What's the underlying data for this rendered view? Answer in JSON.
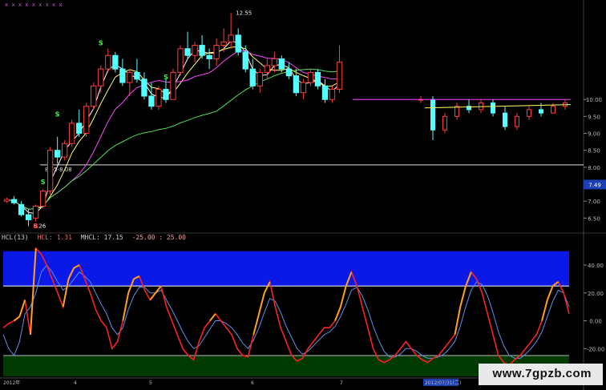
{
  "colors": {
    "background": "#000000",
    "candle_up": "#ff3b3b",
    "candle_down": "#54ffff",
    "ma_short": "#ffffff",
    "ma_mid": "#ffff66",
    "ma_long": "#ff44ff",
    "ma_longest": "#55dd55",
    "hcl": "#ff2020",
    "hcl_alt": "#ffa020",
    "mhcl": "#5f8fe8",
    "band_high": "#0a18e8",
    "band_low": "#003a00",
    "axis_text": "#bbbbbb",
    "price_badge": "#1b3fb3"
  },
  "chart_data": [
    {
      "type": "candlestick",
      "price_axis_ticks": [
        "10.00",
        "9.50",
        "9.00",
        "8.50",
        "8.00",
        "7.50",
        "7.00",
        "6.50"
      ],
      "ylim": [
        6.2,
        12.7
      ],
      "current_price_badge": "7.49",
      "annotations": {
        "high_label": "12.55",
        "low_label": "6.26",
        "horizontal_line_label": "8.05-8.08",
        "signal_marks": [
          "S",
          "S",
          "S",
          "S",
          "B"
        ]
      },
      "top_markers": "x x x x x x x x x",
      "series": [
        {
          "name": "candles",
          "values": [
            [
              7.0,
              7.1,
              6.95,
              7.05
            ],
            [
              7.05,
              7.15,
              6.9,
              6.95
            ],
            [
              6.9,
              7.0,
              6.55,
              6.6
            ],
            [
              6.6,
              6.75,
              6.26,
              6.45
            ],
            [
              6.5,
              6.9,
              6.4,
              6.85
            ],
            [
              6.85,
              7.35,
              6.8,
              7.3
            ],
            [
              7.3,
              8.6,
              7.2,
              8.5
            ],
            [
              8.5,
              8.9,
              8.1,
              8.3
            ],
            [
              8.3,
              8.8,
              8.2,
              8.7
            ],
            [
              8.7,
              9.4,
              8.6,
              9.3
            ],
            [
              9.3,
              9.7,
              8.9,
              9.0
            ],
            [
              9.0,
              9.9,
              8.9,
              9.8
            ],
            [
              9.8,
              10.5,
              9.7,
              10.4
            ],
            [
              10.4,
              11.0,
              10.2,
              10.9
            ],
            [
              10.9,
              11.5,
              10.8,
              11.3
            ],
            [
              11.3,
              11.4,
              10.8,
              10.9
            ],
            [
              10.9,
              11.2,
              10.4,
              10.5
            ],
            [
              10.5,
              10.9,
              10.1,
              10.8
            ],
            [
              10.8,
              11.2,
              10.5,
              10.6
            ],
            [
              10.6,
              10.8,
              10.0,
              10.1
            ],
            [
              10.1,
              10.5,
              9.7,
              9.8
            ],
            [
              9.8,
              10.4,
              9.7,
              10.3
            ],
            [
              10.3,
              10.6,
              9.9,
              10.0
            ],
            [
              10.0,
              10.9,
              10.0,
              10.8
            ],
            [
              10.8,
              11.6,
              10.7,
              11.5
            ],
            [
              11.5,
              12.0,
              11.2,
              11.3
            ],
            [
              11.3,
              11.7,
              11.1,
              11.6
            ],
            [
              11.6,
              11.9,
              11.2,
              11.3
            ],
            [
              11.3,
              11.5,
              10.9,
              11.2
            ],
            [
              11.2,
              11.8,
              11.0,
              11.6
            ],
            [
              11.6,
              12.1,
              11.4,
              11.7
            ],
            [
              11.7,
              12.55,
              11.5,
              11.9
            ],
            [
              11.9,
              12.1,
              11.3,
              11.4
            ],
            [
              11.4,
              11.6,
              10.8,
              10.9
            ],
            [
              10.9,
              11.2,
              10.3,
              10.4
            ],
            [
              10.4,
              10.9,
              10.2,
              10.8
            ],
            [
              10.8,
              11.2,
              10.6,
              11.0
            ],
            [
              11.0,
              11.4,
              10.8,
              11.2
            ],
            [
              11.2,
              11.3,
              10.8,
              10.9
            ],
            [
              10.9,
              11.1,
              10.6,
              10.7
            ],
            [
              10.7,
              10.9,
              10.1,
              10.2
            ],
            [
              10.2,
              10.6,
              10.0,
              10.5
            ],
            [
              10.5,
              10.9,
              10.4,
              10.8
            ],
            [
              10.8,
              10.9,
              10.3,
              10.4
            ],
            [
              10.4,
              10.6,
              9.9,
              10.0
            ],
            [
              10.0,
              10.4,
              9.9,
              10.3
            ],
            [
              10.3,
              11.6,
              10.2,
              11.1
            ]
          ]
        }
      ]
    },
    {
      "type": "line",
      "title": "HCL(13)",
      "legend": {
        "hcl": "HCL: 1.31",
        "mhcl": "MHCL: 17.15",
        "levels": "-25.00 : 25.00"
      },
      "yticks": [
        "40.00",
        "20.00",
        "0.00",
        "-20.00"
      ],
      "ylim": [
        -40,
        55
      ],
      "bands": {
        "upper": [
          25,
          50
        ],
        "lower": [
          -40,
          -25
        ]
      },
      "x_labels": [
        "2012年",
        "4",
        "5",
        "6",
        "7",
        "2012/07/31(二)"
      ],
      "series": [
        {
          "name": "HCL",
          "values": [
            -5,
            -2,
            0,
            3,
            15,
            -10,
            52,
            48,
            40,
            30,
            20,
            10,
            30,
            38,
            40,
            30,
            20,
            8,
            0,
            -5,
            -20,
            -15,
            0,
            20,
            30,
            32,
            22,
            15,
            20,
            25,
            10,
            0,
            -10,
            -20,
            -25,
            -28,
            -15,
            -5,
            0,
            5,
            0,
            -5,
            -10,
            -20,
            -25,
            -26,
            -10,
            5,
            20,
            28,
            10,
            -5,
            -15,
            -25,
            -29,
            -27,
            -20,
            -15,
            -10,
            -5,
            -5,
            0,
            10,
            25,
            35,
            25,
            10,
            -5,
            -20,
            -28,
            -30,
            -28,
            -25,
            -20,
            -15,
            -20,
            -25,
            -28,
            -30,
            -27,
            -25,
            -20,
            -15,
            -10,
            10,
            25,
            35,
            30,
            20,
            5,
            -10,
            -25,
            -30,
            -32,
            -28,
            -25,
            -20,
            -15,
            -10,
            0,
            15,
            25,
            28,
            20,
            5
          ]
        },
        {
          "name": "MHCL",
          "values": [
            -10,
            -20,
            -25,
            -15,
            5,
            10,
            20,
            35,
            40,
            35,
            28,
            22,
            25,
            30,
            35,
            32,
            28,
            20,
            12,
            5,
            -5,
            -10,
            -5,
            8,
            18,
            24,
            24,
            20,
            20,
            22,
            15,
            8,
            0,
            -8,
            -15,
            -20,
            -18,
            -12,
            -6,
            0,
            0,
            -2,
            -5,
            -10,
            -16,
            -20,
            -14,
            -5,
            6,
            16,
            14,
            6,
            -4,
            -12,
            -20,
            -24,
            -22,
            -18,
            -14,
            -10,
            -8,
            -4,
            3,
            12,
            22,
            24,
            18,
            8,
            -4,
            -14,
            -22,
            -26,
            -26,
            -24,
            -20,
            -20,
            -22,
            -25,
            -27,
            -27,
            -26,
            -24,
            -20,
            -15,
            -4,
            10,
            22,
            28,
            26,
            18,
            6,
            -8,
            -18,
            -25,
            -27,
            -27,
            -24,
            -20,
            -15,
            -8,
            3,
            14,
            22,
            20,
            10
          ]
        }
      ]
    }
  ]
}
